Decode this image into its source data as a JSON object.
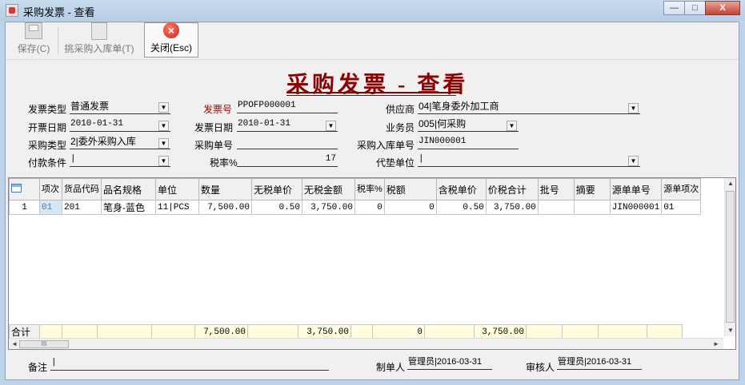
{
  "window": {
    "title": "采购发票 - 查看",
    "controls": {
      "minimize": "—",
      "maximize": "□",
      "close": "X"
    }
  },
  "toolbar": {
    "save": "保存(C)",
    "pick": "挑采购入库单(T)",
    "close": "关闭(Esc)"
  },
  "header": {
    "title": "采购发票 - 查看"
  },
  "form": {
    "invoice_type": {
      "label": "发票类型",
      "value": "普通发票"
    },
    "open_date": {
      "label": "开票日期",
      "value": "2010-01-31"
    },
    "purchase_type": {
      "label": "采购类型",
      "value": "2|委外采购入库"
    },
    "payment_terms": {
      "label": "付款条件",
      "value": "|"
    },
    "invoice_no": {
      "label": "发票号",
      "value": "PPOFP000001"
    },
    "invoice_date": {
      "label": "发票日期",
      "value": "2010-01-31"
    },
    "purchase_order_no": {
      "label": "采购单号",
      "value": ""
    },
    "tax_rate": {
      "label": "税率%",
      "value": "17"
    },
    "supplier": {
      "label": "供应商",
      "value": "04|笔身委外加工商"
    },
    "salesman": {
      "label": "业务员",
      "value": "005|何采购"
    },
    "receipt_no": {
      "label": "采购入库单号",
      "value": "JIN000001"
    },
    "advance_unit": {
      "label": "代垫单位",
      "value": "|"
    }
  },
  "grid": {
    "columns": [
      "",
      "项次",
      "货品代码",
      "品名规格",
      "单位",
      "数量",
      "无税单价",
      "无税金额",
      "税率%",
      "税额",
      "含税单价",
      "价税合计",
      "批号",
      "摘要",
      "源单单号",
      "源单项次"
    ],
    "rows": [
      [
        "1",
        "01",
        "201",
        "笔身-蓝色",
        "11|PCS",
        "7,500.00",
        "0.50",
        "3,750.00",
        "0",
        "0",
        "0.50",
        "3,750.00",
        "",
        "",
        "JIN000001",
        "01"
      ]
    ],
    "totals": {
      "label": "合计",
      "qty": "7,500.00",
      "amount": "3,750.00",
      "tax": "0",
      "total": "3,750.00"
    },
    "hscroll_thumb": "III"
  },
  "footer": {
    "remark": {
      "label": "备注",
      "value": "|"
    },
    "maker": {
      "label": "制单人",
      "value": "管理员|2016-03-31"
    },
    "reviewer": {
      "label": "审核人",
      "value": "管理员|2016-03-31"
    }
  }
}
